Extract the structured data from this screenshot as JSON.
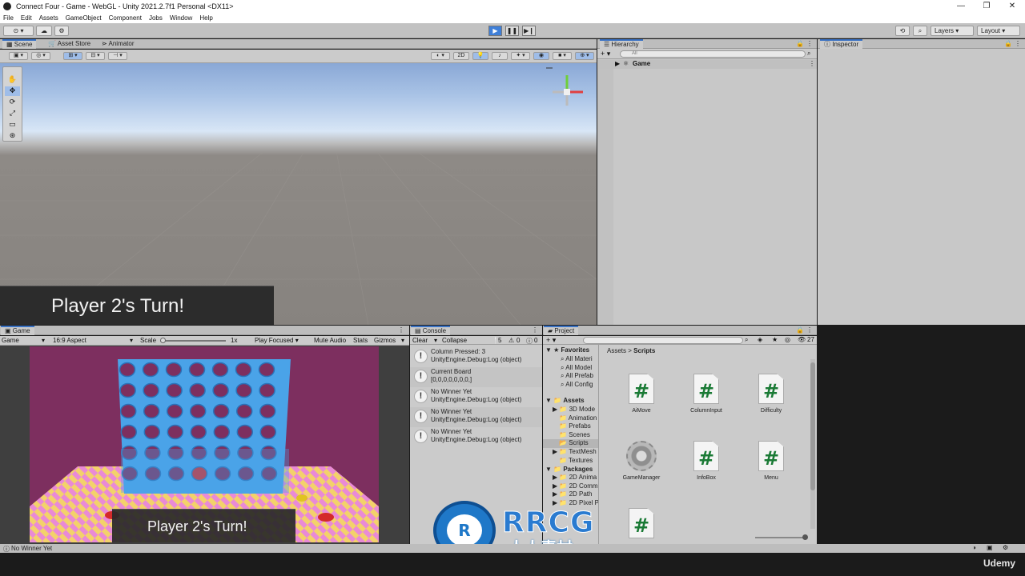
{
  "window": {
    "title": "Connect Four - Game - WebGL - Unity 2021.2.7f1 Personal <DX11>",
    "controls": [
      "—",
      "❐",
      "✕"
    ]
  },
  "menu": [
    "File",
    "Edit",
    "Assets",
    "GameObject",
    "Component",
    "Jobs",
    "Window",
    "Help"
  ],
  "toolbar": {
    "account": "⊙ ▾",
    "layers": "Layers",
    "layout": "Layout"
  },
  "scene_tabs": [
    "Scene",
    "Asset Store",
    "Animator"
  ],
  "scene_toolbar": {
    "mode_2d": "2D"
  },
  "scene_banner": "Player 2's Turn!",
  "hierarchy": {
    "tab": "Hierarchy",
    "search_placeholder": "All",
    "root": "Game"
  },
  "inspector": {
    "tab": "Inspector"
  },
  "game": {
    "tab": "Game",
    "display": "Game",
    "aspect": "16:9 Aspect",
    "scale_label": "Scale",
    "scale_value": "1x",
    "play_focused": "Play Focused",
    "mute_audio": "Mute Audio",
    "stats": "Stats",
    "gizmos": "Gizmos",
    "banner": "Player 2's Turn!"
  },
  "console": {
    "tab": "Console",
    "clear": "Clear",
    "collapse": "Collapse",
    "count_info": "5",
    "count_warn": "0",
    "count_error": "0",
    "logs": [
      {
        "line1": "Column Pressed: 3",
        "line2": "UnityEngine.Debug:Log (object)"
      },
      {
        "line1": "Current Board",
        "line2": "[0,0,0,0,0,0,0,]"
      },
      {
        "line1": "No Winner Yet",
        "line2": "UnityEngine.Debug:Log (object)"
      },
      {
        "line1": "No Winner Yet",
        "line2": "UnityEngine.Debug:Log (object)"
      },
      {
        "line1": "No Winner Yet",
        "line2": "UnityEngine.Debug:Log (object)"
      }
    ]
  },
  "project": {
    "tab": "Project",
    "count": "27",
    "breadcrumb_root": "Assets",
    "breadcrumb_sep": ">",
    "breadcrumb_current": "Scripts",
    "favorites_label": "Favorites",
    "favorites": [
      "All Materi",
      "All Model",
      "All Prefab",
      "All Config"
    ],
    "assets_label": "Assets",
    "asset_folders": [
      "3D Mode",
      "Animation",
      "Prefabs",
      "Scenes",
      "Scripts",
      "TextMesh",
      "Textures"
    ],
    "packages_label": "Packages",
    "packages": [
      "2D Anima",
      "2D Comm",
      "2D Path",
      "2D Pixel P"
    ],
    "files": [
      "AiMove",
      "ColumnInput",
      "Difficulty",
      "GameManager",
      "InfoBox",
      "Menu"
    ]
  },
  "status": {
    "message": "No Winner Yet"
  },
  "watermark": {
    "logo": "RRCG",
    "sub": "人人素材",
    "brand": "Udemy"
  },
  "colors": {
    "accent": "#3a72c4",
    "board": "#4aa3e8",
    "game_bg": "#7d2f5f",
    "checker_pink": "#e98ad6",
    "checker_yellow": "#f3d26a",
    "piece_red": "#d42a2a",
    "script_hash": "#1a7a35"
  }
}
